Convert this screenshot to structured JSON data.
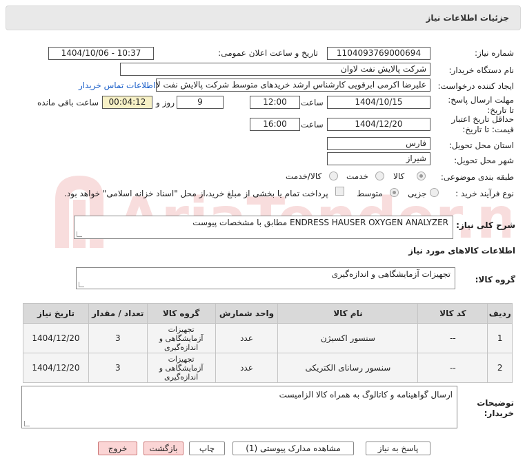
{
  "header": {
    "title": "جزئیات اطلاعات نیاز"
  },
  "form": {
    "need_number_label": "شماره نیاز:",
    "need_number": "1104093769000694",
    "announce_label": "تاریخ و ساعت اعلان عمومی:",
    "announce_value": "1404/10/06 - 10:37",
    "buyer_org_label": "نام دستگاه خریدار:",
    "buyer_org": "شرکت پالایش نفت لاوان",
    "requester_label": "ایجاد کننده درخواست:",
    "requester": "علیرضا اکرمی ابرقویی کارشناس ارشد خریدهای متوسط شرکت پالایش نفت لاوان",
    "contact_link": "اطلاعات تماس خریدار",
    "deadline_label": "مهلت ارسال پاسخ: تا تاریخ:",
    "deadline_date": "1404/10/15",
    "time_label": "ساعت",
    "deadline_time": "12:00",
    "days": "9",
    "days_label": "روز و",
    "remaining": "00:04:12",
    "remaining_label": "ساعت باقی مانده",
    "validity_label": "حداقل تاریخ اعتبار قیمت: تا تاریخ:",
    "validity_date": "1404/12/20",
    "validity_time": "16:00",
    "province_label": "استان محل تحویل:",
    "province": "فارس",
    "city_label": "شهر محل تحویل:",
    "city": "شیراز",
    "category_label": "طبقه بندی موضوعی:",
    "category_options": [
      "کالا",
      "خدمت",
      "کالا/خدمت"
    ],
    "process_label": "نوع فرآیند خرید :",
    "process_options": [
      "جزیی",
      "متوسط"
    ],
    "payment_note": "پرداخت تمام یا بخشی از مبلغ خرید،از محل \"اسناد خزانه اسلامی\" خواهد بود."
  },
  "description": {
    "label": "شرح کلی نیاز:",
    "value": "ENDRESS HAUSER OXYGEN ANALYZER مطابق با مشخصات پیوست"
  },
  "goods": {
    "section_title": "اطلاعات کالاهای مورد نیاز",
    "group_label": "گروه کالا:",
    "group_value": "تجهیزات آزمایشگاهی و اندازه‌گیری",
    "columns": [
      "ردیف",
      "کد کالا",
      "نام کالا",
      "واحد شمارش",
      "گروه کالا",
      "تعداد / مقدار",
      "تاریخ نیاز"
    ],
    "rows": [
      {
        "row": "1",
        "code": "--",
        "name": "سنسور اکسیژن",
        "unit": "عدد",
        "group": "تجهیزات آزمایشگاهی و اندازه‌گیری",
        "qty": "3",
        "date": "1404/12/20"
      },
      {
        "row": "2",
        "code": "--",
        "name": "سنسور رسانای الکتریکی",
        "unit": "عدد",
        "group": "تجهیزات آزمایشگاهی و اندازه‌گیری",
        "qty": "3",
        "date": "1404/12/20"
      }
    ]
  },
  "notes": {
    "label": "توضیحات خریدار:",
    "value": "ارسال گواهینامه و کاتالوگ به همراه کالا الزامیست"
  },
  "buttons": {
    "reply": "پاسخ به نیاز",
    "attachments": "مشاهده مدارک پیوستی (1)",
    "print": "چاپ",
    "back": "بازگشت",
    "exit": "خروج"
  },
  "watermark": {
    "text": "AriaTender.neT"
  }
}
